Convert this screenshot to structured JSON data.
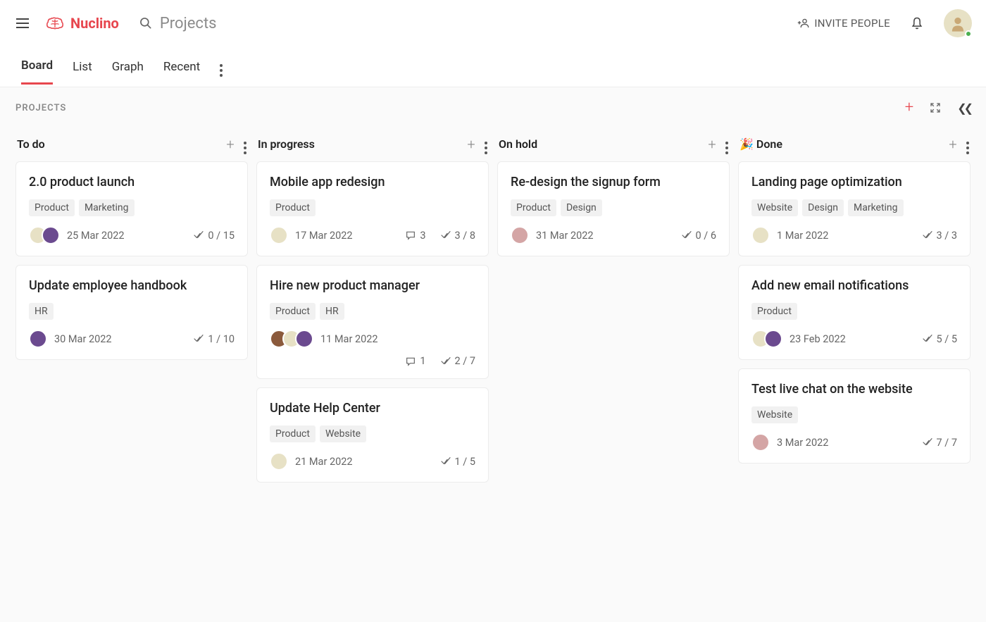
{
  "header": {
    "logo_text": "Nuclino",
    "breadcrumb": "Projects",
    "invite_label": "INVITE PEOPLE"
  },
  "tabs": [
    {
      "label": "Board",
      "active": true
    },
    {
      "label": "List",
      "active": false
    },
    {
      "label": "Graph",
      "active": false
    },
    {
      "label": "Recent",
      "active": false
    }
  ],
  "board": {
    "title": "PROJECTS",
    "columns": [
      {
        "title": "To do",
        "emoji": "",
        "cards": [
          {
            "title": "2.0 product launch",
            "tags": [
              "Product",
              "Marketing"
            ],
            "avatars": [
              "av1",
              "av2"
            ],
            "date": "25 Mar 2022",
            "comments": null,
            "checks": "0 / 15",
            "two_row": false
          },
          {
            "title": "Update employee handbook",
            "tags": [
              "HR"
            ],
            "avatars": [
              "av2"
            ],
            "date": "30 Mar 2022",
            "comments": null,
            "checks": "1 / 10",
            "two_row": false
          }
        ]
      },
      {
        "title": "In progress",
        "emoji": "",
        "cards": [
          {
            "title": "Mobile app redesign",
            "tags": [
              "Product"
            ],
            "avatars": [
              "av1"
            ],
            "date": "17 Mar 2022",
            "comments": "3",
            "checks": "3 / 8",
            "two_row": false
          },
          {
            "title": "Hire new product manager",
            "tags": [
              "Product",
              "HR"
            ],
            "avatars": [
              "av3",
              "av1",
              "av2"
            ],
            "date": "11 Mar 2022",
            "comments": "1",
            "checks": "2 / 7",
            "two_row": true
          },
          {
            "title": "Update Help Center",
            "tags": [
              "Product",
              "Website"
            ],
            "avatars": [
              "av1"
            ],
            "date": "21 Mar 2022",
            "comments": null,
            "checks": "1 / 5",
            "two_row": false
          }
        ]
      },
      {
        "title": "On hold",
        "emoji": "",
        "cards": [
          {
            "title": "Re-design the signup form",
            "tags": [
              "Product",
              "Design"
            ],
            "avatars": [
              "av4"
            ],
            "date": "31 Mar 2022",
            "comments": null,
            "checks": "0 / 6",
            "two_row": false
          }
        ]
      },
      {
        "title": "Done",
        "emoji": "🎉",
        "cards": [
          {
            "title": "Landing page optimization",
            "tags": [
              "Website",
              "Design",
              "Marketing"
            ],
            "avatars": [
              "av1"
            ],
            "date": "1 Mar 2022",
            "comments": null,
            "checks": "3 / 3",
            "two_row": false
          },
          {
            "title": "Add new email notifications",
            "tags": [
              "Product"
            ],
            "avatars": [
              "av1",
              "av2"
            ],
            "date": "23 Feb 2022",
            "comments": null,
            "checks": "5 / 5",
            "two_row": false
          },
          {
            "title": "Test live chat on the website",
            "tags": [
              "Website"
            ],
            "avatars": [
              "av4"
            ],
            "date": "3 Mar 2022",
            "comments": null,
            "checks": "7 / 7",
            "two_row": false
          }
        ]
      }
    ]
  }
}
